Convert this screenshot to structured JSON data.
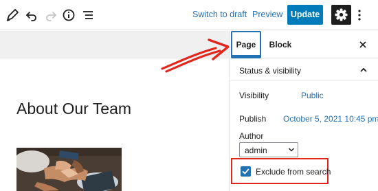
{
  "toolbar": {
    "edit_icon": "pencil-icon",
    "undo_icon": "undo-icon",
    "redo_icon": "redo-icon",
    "info_icon": "info-icon",
    "outline_icon": "list-view-icon",
    "switch_draft_label": "Switch to draft",
    "preview_label": "Preview",
    "update_label": "Update",
    "settings_icon": "gear-icon",
    "more_icon": "more-vertical-icon"
  },
  "editor": {
    "title": "About Our Team"
  },
  "sidebar": {
    "tabs": [
      {
        "label": "Page",
        "active": true
      },
      {
        "label": "Block",
        "active": false
      }
    ],
    "close_icon": "close-icon",
    "panel": {
      "title": "Status & visibility",
      "expanded": true,
      "visibility_label": "Visibility",
      "visibility_value": "Public",
      "publish_label": "Publish",
      "publish_value": "October 5, 2021 10:45 pm",
      "author_label": "Author",
      "author_value": "admin",
      "exclude_label": "Exclude from search",
      "exclude_checked": true
    }
  },
  "colors": {
    "accent": "#007cba",
    "link": "#2271b1",
    "highlight": "#e3261c",
    "dark": "#1e1e1e"
  }
}
